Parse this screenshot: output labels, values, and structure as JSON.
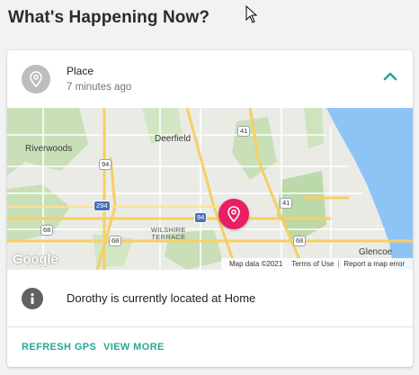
{
  "page": {
    "title": "What's Happening Now?"
  },
  "card": {
    "header": {
      "title": "Place",
      "time": "7 minutes ago"
    },
    "map": {
      "labels": {
        "riverwoods": "Riverwoods",
        "deerfield": "Deerfield",
        "wilshire": "WILSHIRE\nTERRACE",
        "glencoe": "Glencoe"
      },
      "shields": {
        "i94_a": "94",
        "i294": "294",
        "i94_b": "94",
        "r41_a": "41",
        "r41_b": "41",
        "r68_a": "68",
        "r68_b": "68",
        "r68_c": "68"
      },
      "google": "Google",
      "footer": {
        "map_data": "Map data ©2021",
        "terms": "Terms of Use",
        "report": "Report a map error"
      }
    },
    "status": {
      "text": "Dorothy is currently located at Home"
    },
    "actions": {
      "refresh": "REFRESH GPS",
      "view_more": "VIEW MORE"
    }
  },
  "colors": {
    "accent": "#26a69a",
    "pin": "#e91e63",
    "water": "#8ec3f5"
  },
  "icons": {
    "avatar": "location-pin-icon",
    "collapse": "chevron-up-icon",
    "info": "info-icon",
    "map_pin": "location-pin-icon"
  }
}
